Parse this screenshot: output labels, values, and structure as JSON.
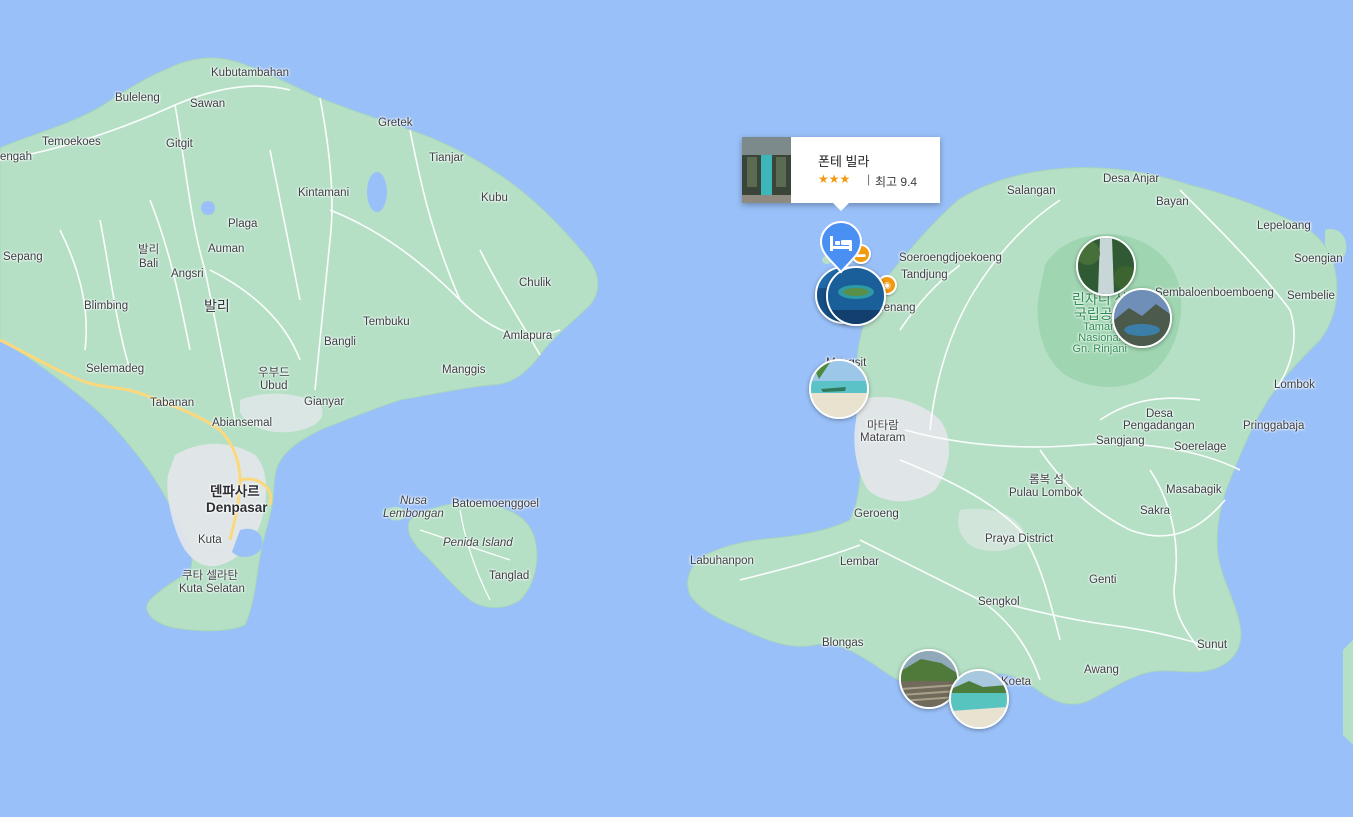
{
  "popup": {
    "hotel_name": "폰테 빌라",
    "stars": "★★★",
    "separator": "|",
    "score_text": "최고 9.4"
  },
  "labels": {
    "kubutambahan": "Kubutambahan",
    "buleleng": "Buleleng",
    "sawan": "Sawan",
    "temoekoes": "Temoekoes",
    "gitgit": "Gitgit",
    "gretek": "Gretek",
    "engah": "engah",
    "tianjar": "Tianjar",
    "kintamani": "Kintamani",
    "kubu": "Kubu",
    "plaga": "Plaga",
    "bali_ko": "발리",
    "bali_en": "Bali",
    "auman": "Auman",
    "sepang": "Sepang",
    "angsri": "Angsri",
    "chulik": "Chulik",
    "bali_big": "발리",
    "blimbing": "Blimbing",
    "tembuku": "Tembuku",
    "amlapura": "Amlapura",
    "bangli": "Bangli",
    "selemadeg": "Selemadeg",
    "ubud_ko": "우부드",
    "ubud_en": "Ubud",
    "manggis": "Manggis",
    "tabanan": "Tabanan",
    "gianyar": "Gianyar",
    "abiansemal": "Abiansemal",
    "denpasar_ko": "덴파사르",
    "denpasar_en": "Denpasar",
    "nusa": "Nusa",
    "lembongan": "Lembongan",
    "batoemoenggoel": "Batoemoenggoel",
    "penida": "Penida Island",
    "kuta": "Kuta",
    "kuta_selatan_ko": "쿠타 셀라탄",
    "kuta_selatan_en": "Kuta Selatan",
    "tanglad": "Tanglad",
    "salangan": "Salangan",
    "desa_anjar": "Desa Anjar",
    "bayan": "Bayan",
    "lepeloang": "Lepeloang",
    "soeroeng": "Soeroengdjoekoeng",
    "tandjung": "Tandjung",
    "soengian": "Soengian",
    "sembaloen": "Sembaloenboemboeng",
    "sembelie": "Sembelie",
    "nenang": "menang",
    "rinjani_ko_1": "린자니 산",
    "rinjani_ko_2": "국립공원",
    "rinjani_en_1": "Taman",
    "rinjani_en_2": "Nasional",
    "rinjani_en_3": "Gn. Rinjani",
    "mangsit": "Mangsit",
    "lombok_east": "Lombok",
    "desa_peng_1": "Desa",
    "desa_peng_2": "Pengadangan",
    "pringgabaja": "Pringgabaja",
    "mataram_ko": "마타람",
    "mataram_en": "Mataram",
    "sangjang": "Sangjang",
    "soerelage": "Soerelage",
    "lombok_ko": "롬복 섬",
    "lombok_en": "Pulau Lombok",
    "masabagik": "Masabagik",
    "geroeng": "Geroeng",
    "sakra": "Sakra",
    "praya": "Praya District",
    "labuhanpon": "Labuhanpon",
    "lembar": "Lembar",
    "genti": "Genti",
    "sengkol": "Sengkol",
    "sunut": "Sunut",
    "blongas": "Blongas",
    "awang": "Awang",
    "koeta": "Koeta"
  },
  "colors": {
    "sea": "#99c0f8",
    "land": "#b5e0c6",
    "park": "#9fd6b1",
    "city_area": "#e4e7ea",
    "highway": "#fcd87d",
    "hotel_pin": "#4a8ff2",
    "poi_orange": "#f29a0e",
    "star": "#f29a0e"
  },
  "icons": {
    "hotel_pin": "bed-icon",
    "orange_pois": [
      "hotel-small-icon",
      "camera-icon"
    ],
    "photo_markers": [
      "gili-island-photo",
      "gili-island-photo-2",
      "beach-photo",
      "waterfall-photo",
      "rinjani-crater-photo",
      "selong-belanak-photo",
      "tanjung-aan-photo"
    ]
  }
}
